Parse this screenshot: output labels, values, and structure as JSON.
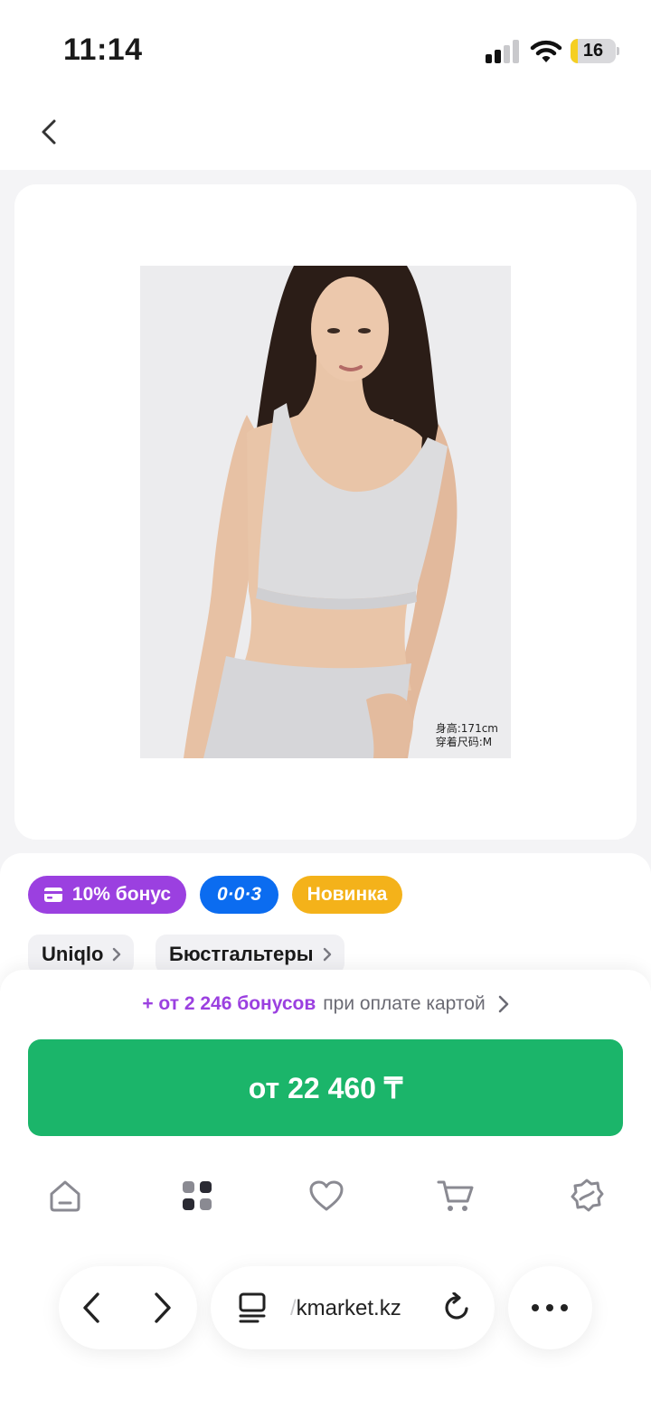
{
  "status_bar": {
    "time": "11:14",
    "battery_level": "16",
    "battery_color": "#f5cf22"
  },
  "header": {
    "back_icon": "chevron-left-icon"
  },
  "product_image": {
    "caption_line1": "身高:171cm",
    "caption_line2": "穿着尺码:M"
  },
  "badges": {
    "bonus": "10% бонус",
    "installment": "0·0·3",
    "new": "Новинка"
  },
  "breadcrumbs": {
    "brand": "Uniqlo",
    "category": "Бюстгальтеры"
  },
  "purchase": {
    "bonus_amount": "+ от 2 246 бонусов",
    "bonus_note": "при оплате картой",
    "price_button": "от 22 460 ₸"
  },
  "tabs": [
    {
      "icon": "home-icon"
    },
    {
      "icon": "catalog-icon"
    },
    {
      "icon": "heart-icon"
    },
    {
      "icon": "cart-icon"
    },
    {
      "icon": "account-icon"
    }
  ],
  "browser": {
    "url_prefix": "/",
    "url_domain": "kmarket.kz"
  },
  "colors": {
    "accent_purple": "#9b40e0",
    "accent_blue": "#0b6cf0",
    "accent_yellow": "#f4b21a",
    "buy_green": "#1bb56a"
  }
}
